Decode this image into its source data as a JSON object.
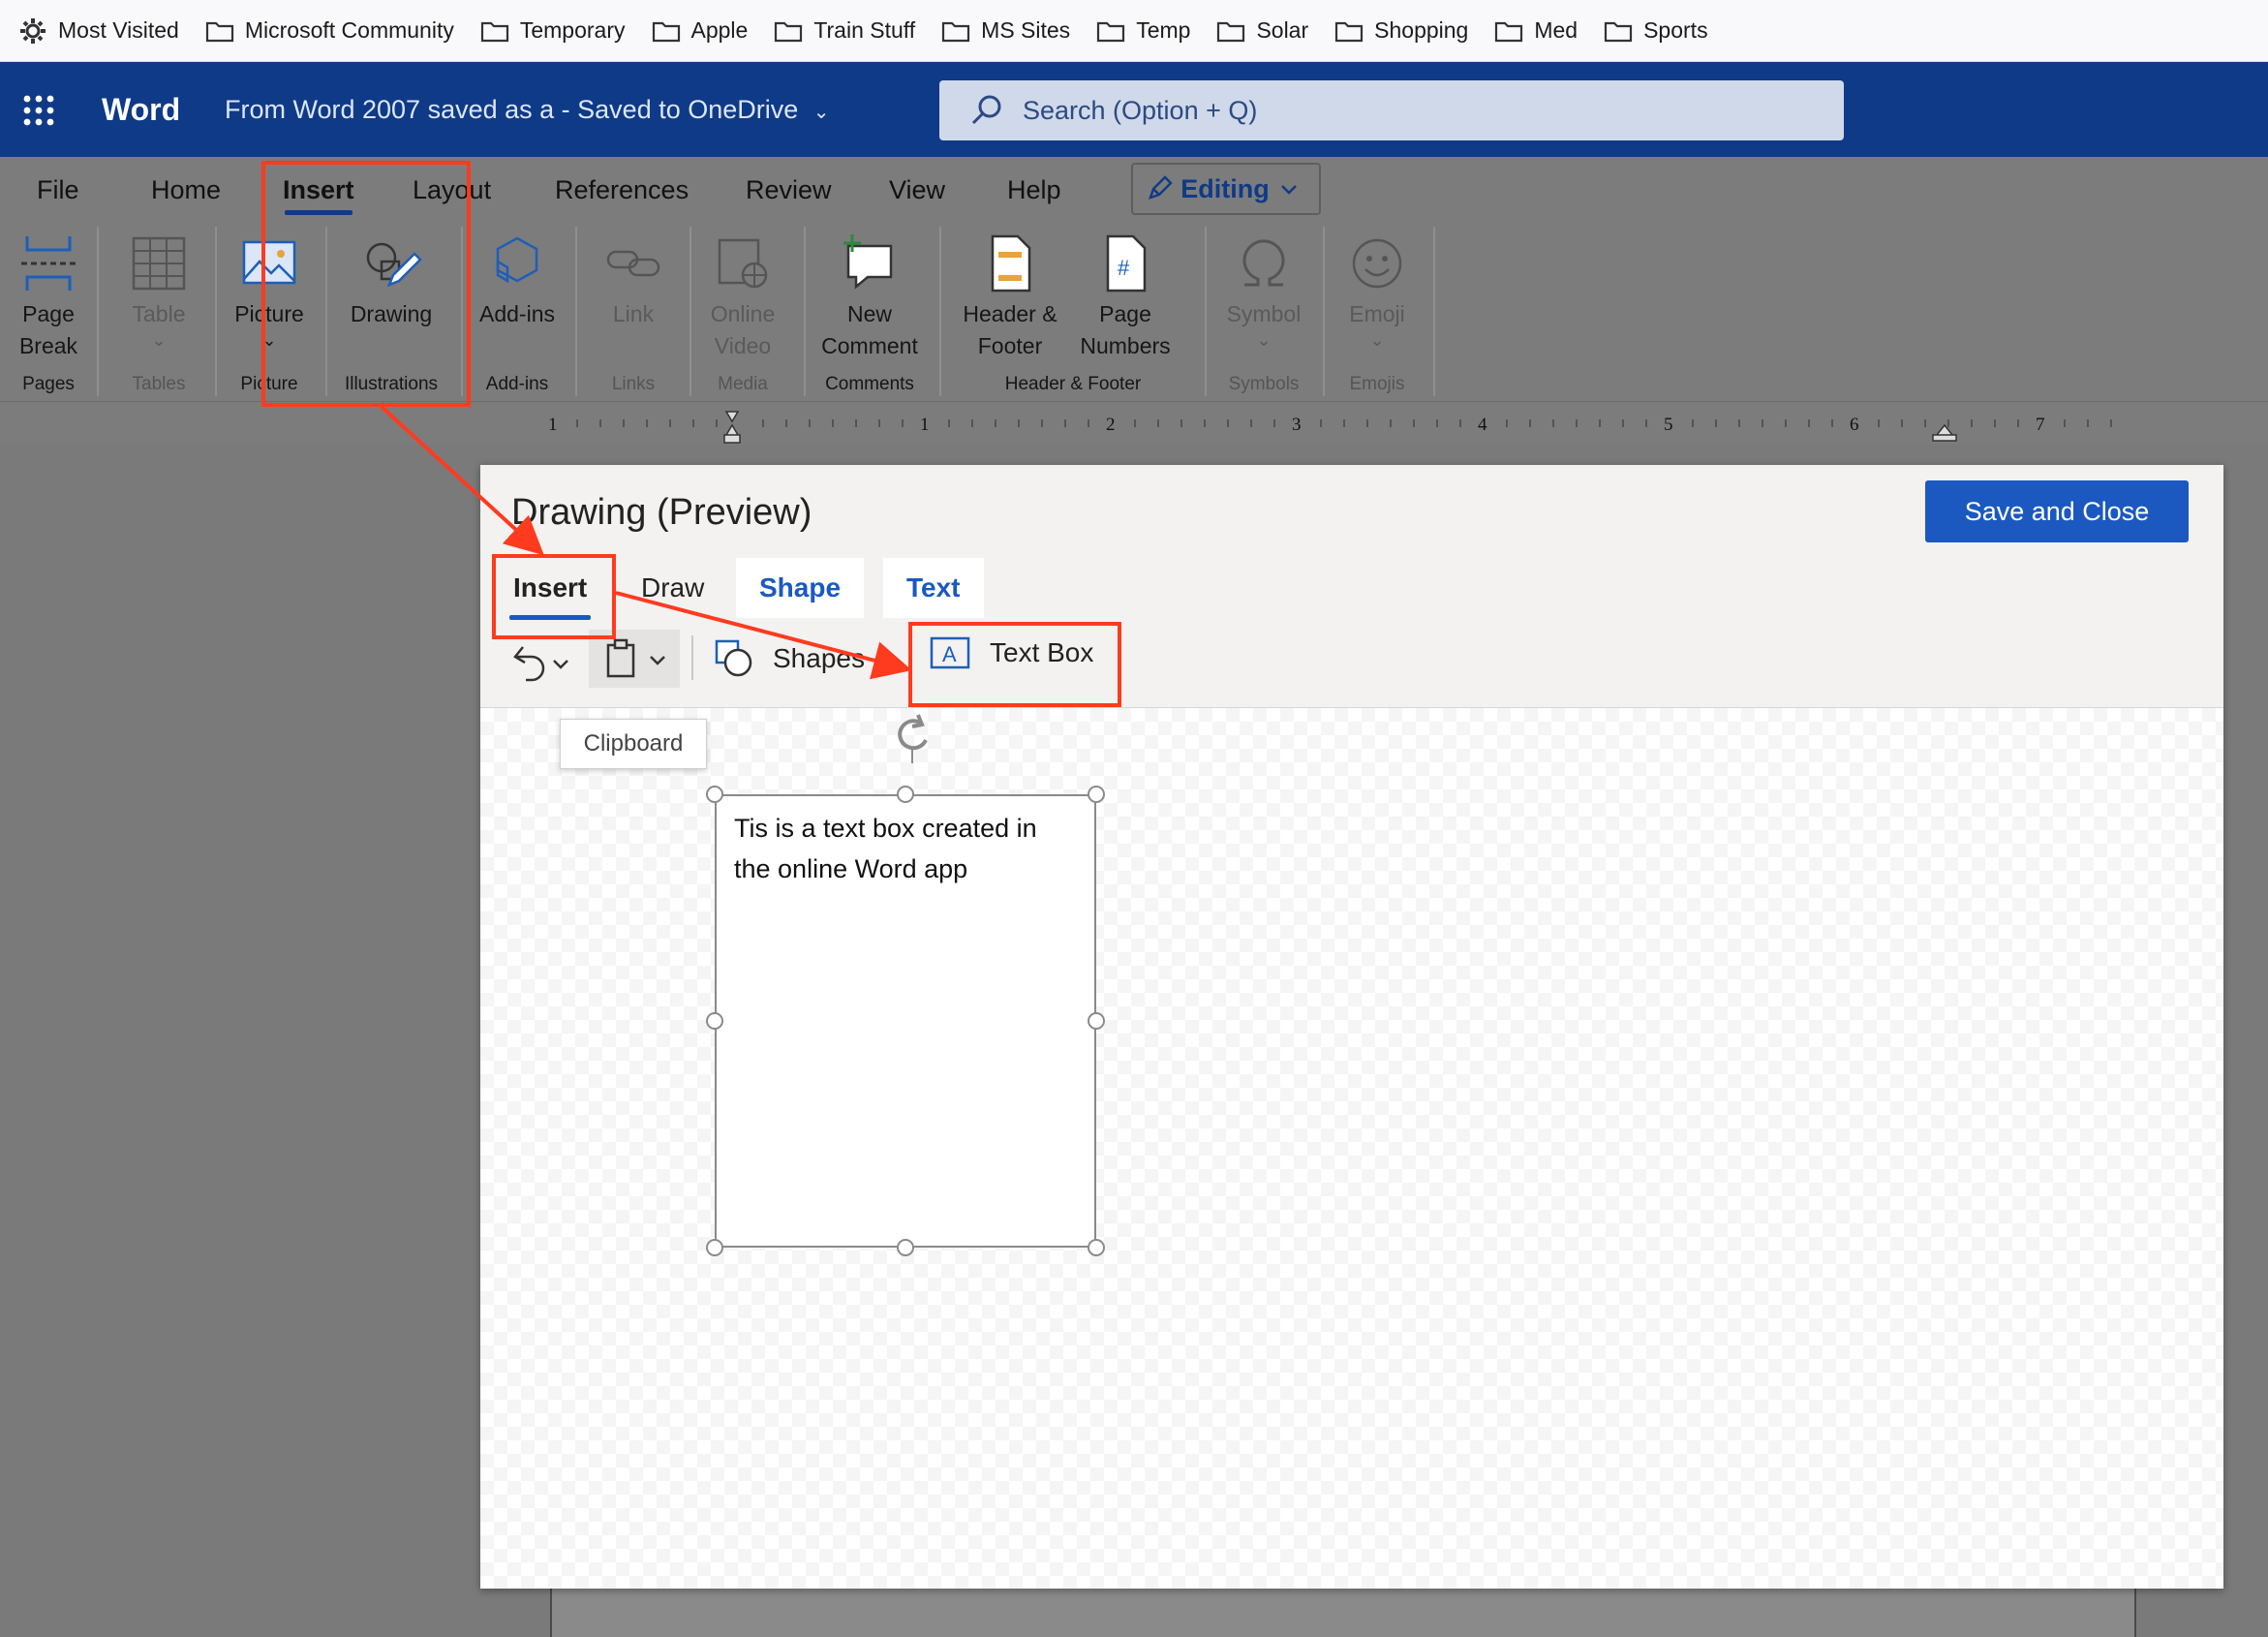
{
  "bookmarks": [
    {
      "label": "Most Visited",
      "icon": "gear-icon"
    },
    {
      "label": "Microsoft Community",
      "icon": "folder-icon"
    },
    {
      "label": "Temporary",
      "icon": "folder-icon"
    },
    {
      "label": "Apple",
      "icon": "folder-icon"
    },
    {
      "label": "Train Stuff",
      "icon": "folder-icon"
    },
    {
      "label": "MS Sites",
      "icon": "folder-icon"
    },
    {
      "label": "Temp",
      "icon": "folder-icon"
    },
    {
      "label": "Solar",
      "icon": "folder-icon"
    },
    {
      "label": "Shopping",
      "icon": "folder-icon"
    },
    {
      "label": "Med",
      "icon": "folder-icon"
    },
    {
      "label": "Sports",
      "icon": "folder-icon"
    }
  ],
  "titlebar": {
    "app": "Word",
    "document": "From Word 2007 saved as a  -  Saved to OneDrive",
    "search_placeholder": "Search (Option + Q)"
  },
  "ribbon": {
    "tabs": [
      "File",
      "Home",
      "Insert",
      "Layout",
      "References",
      "Review",
      "View",
      "Help"
    ],
    "active_tab": "Insert",
    "mode": "Editing",
    "buttons": {
      "page_break": [
        "Page",
        "Break"
      ],
      "table": "Table",
      "picture": "Picture",
      "drawing": "Drawing",
      "addins": "Add-ins",
      "link": "Link",
      "online_video": [
        "Online",
        "Video"
      ],
      "new_comment": [
        "New",
        "Comment"
      ],
      "header_footer": [
        "Header &",
        "Footer"
      ],
      "page_numbers": [
        "Page",
        "Numbers"
      ],
      "symbol": "Symbol",
      "emoji": "Emoji"
    },
    "groups": {
      "pages": "Pages",
      "tables": "Tables",
      "picture": "Picture",
      "illustrations": "Illustrations",
      "addins": "Add-ins",
      "links": "Links",
      "media": "Media",
      "comments": "Comments",
      "header_footer": "Header & Footer",
      "symbols": "Symbols",
      "emojis": "Emojis"
    }
  },
  "ruler": {
    "numbers": [
      "1",
      "1",
      "2",
      "3",
      "4",
      "5",
      "6",
      "7"
    ]
  },
  "dialog": {
    "title": "Drawing (Preview)",
    "save_close": "Save and Close",
    "tabs": [
      "Insert",
      "Draw",
      "Shape",
      "Text"
    ],
    "active_tab": "Insert",
    "toolbar": {
      "shapes": "Shapes",
      "textbox": "Text Box"
    },
    "tooltip": "Clipboard",
    "textbox_content": "Tis is a text box created in the online Word app"
  },
  "colors": {
    "word_blue": "#0f3a87",
    "accent_blue": "#1b59c1",
    "annotation_red": "#ff3b1f"
  }
}
